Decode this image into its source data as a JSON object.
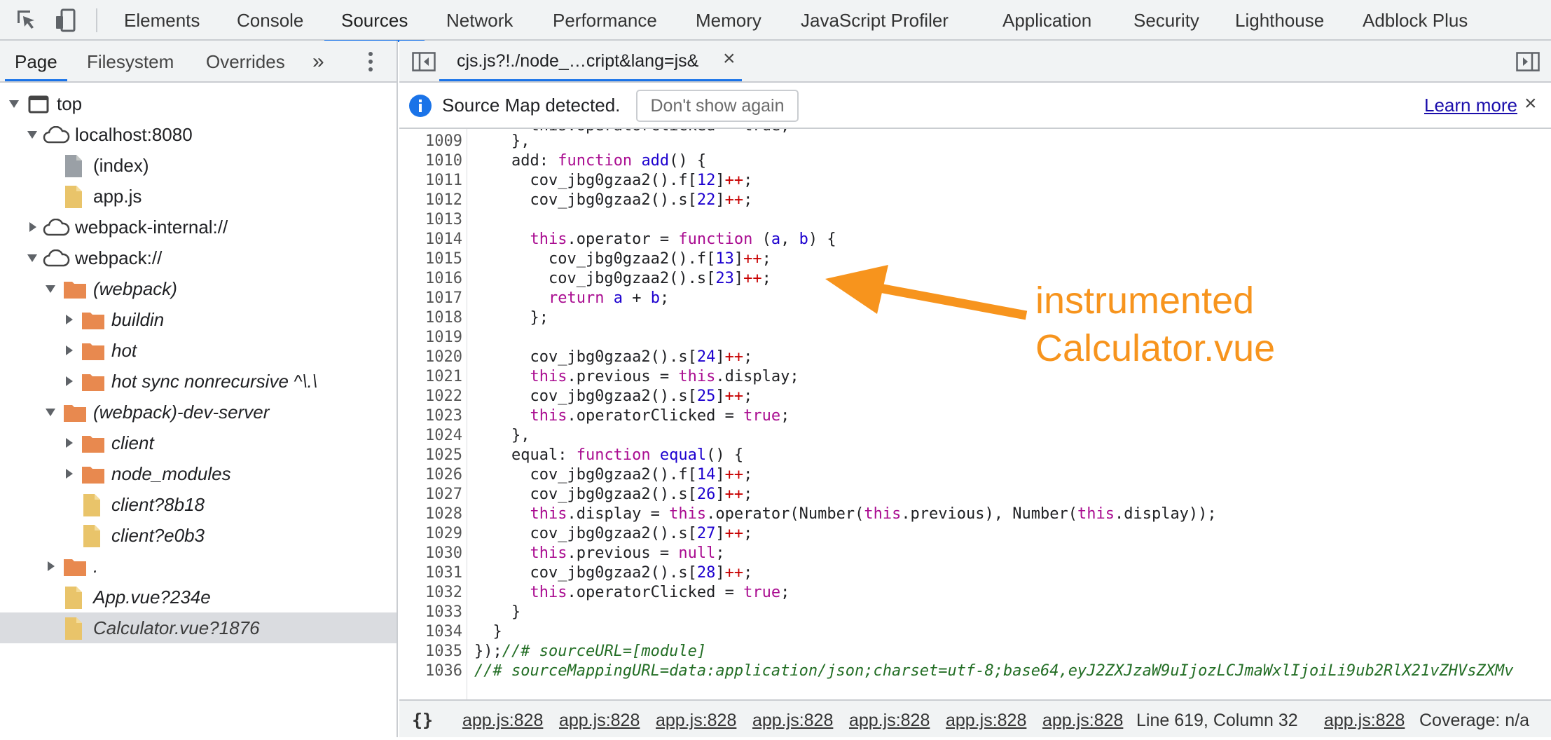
{
  "toolbar": {
    "tabs": [
      "Elements",
      "Console",
      "Sources",
      "Network",
      "Performance",
      "Memory",
      "JavaScript Profiler",
      "Application",
      "Security",
      "Lighthouse",
      "Adblock Plus"
    ],
    "active_tab": "Sources"
  },
  "navigator": {
    "tabs": [
      "Page",
      "Filesystem",
      "Overrides"
    ],
    "more": "»",
    "tree": [
      {
        "label": "top",
        "expanded": true,
        "icon": "frame-icon"
      },
      {
        "label": "localhost:8080",
        "expanded": true,
        "icon": "cloud-icon"
      },
      {
        "label": "(index)",
        "icon": "file-gray-icon"
      },
      {
        "label": "app.js",
        "icon": "file-js-icon"
      },
      {
        "label": "webpack-internal://",
        "expanded": false,
        "icon": "cloud-icon"
      },
      {
        "label": "webpack://",
        "expanded": true,
        "icon": "cloud-icon"
      },
      {
        "label": "(webpack)",
        "expanded": true,
        "icon": "folder-icon"
      },
      {
        "label": "buildin",
        "expanded": false,
        "icon": "folder-icon"
      },
      {
        "label": "hot",
        "expanded": false,
        "icon": "folder-icon"
      },
      {
        "label": "hot sync nonrecursive ^\\.\\",
        "expanded": false,
        "icon": "folder-icon"
      },
      {
        "label": "(webpack)-dev-server",
        "expanded": true,
        "icon": "folder-icon"
      },
      {
        "label": "client",
        "expanded": false,
        "icon": "folder-icon"
      },
      {
        "label": "node_modules",
        "expanded": false,
        "icon": "folder-icon"
      },
      {
        "label": "client?8b18",
        "icon": "file-js-icon"
      },
      {
        "label": "client?e0b3",
        "icon": "file-js-icon"
      },
      {
        "label": ".",
        "expanded": false,
        "icon": "folder-icon"
      },
      {
        "label": "App.vue?234e",
        "icon": "file-js-icon"
      },
      {
        "label": "Calculator.vue?1876",
        "icon": "file-js-icon",
        "selected": true
      }
    ]
  },
  "editor": {
    "file_tab": "cjs.js?!./node_…cript&lang=js&",
    "close": "×",
    "infobar": {
      "message": "Source Map detected.",
      "dont_show": "Don't show again",
      "learn_more": "Learn more",
      "close": "×"
    },
    "partial_top_line": "      this.operatorClicked = true;",
    "lines": [
      {
        "n": "1009",
        "code": [
          {
            "t": "    },"
          }
        ]
      },
      {
        "n": "1010",
        "code": [
          {
            "t": "    add: "
          },
          {
            "t": "function",
            "c": "kw"
          },
          {
            "t": " "
          },
          {
            "t": "add",
            "c": "fn"
          },
          {
            "t": "() {"
          }
        ]
      },
      {
        "n": "1011",
        "code": [
          {
            "t": "      cov_jbg0gzaa2().f["
          },
          {
            "t": "12",
            "c": "num"
          },
          {
            "t": "]"
          },
          {
            "t": "++",
            "c": "op"
          },
          {
            "t": ";"
          }
        ]
      },
      {
        "n": "1012",
        "code": [
          {
            "t": "      cov_jbg0gzaa2().s["
          },
          {
            "t": "22",
            "c": "num"
          },
          {
            "t": "]"
          },
          {
            "t": "++",
            "c": "op"
          },
          {
            "t": ";"
          }
        ]
      },
      {
        "n": "1013",
        "code": [
          {
            "t": ""
          }
        ]
      },
      {
        "n": "1014",
        "code": [
          {
            "t": "      "
          },
          {
            "t": "this",
            "c": "kw"
          },
          {
            "t": ".operator = "
          },
          {
            "t": "function",
            "c": "kw"
          },
          {
            "t": " ("
          },
          {
            "t": "a",
            "c": "fn"
          },
          {
            "t": ", "
          },
          {
            "t": "b",
            "c": "fn"
          },
          {
            "t": ") {"
          }
        ]
      },
      {
        "n": "1015",
        "code": [
          {
            "t": "        cov_jbg0gzaa2().f["
          },
          {
            "t": "13",
            "c": "num"
          },
          {
            "t": "]"
          },
          {
            "t": "++",
            "c": "op"
          },
          {
            "t": ";"
          }
        ]
      },
      {
        "n": "1016",
        "code": [
          {
            "t": "        cov_jbg0gzaa2().s["
          },
          {
            "t": "23",
            "c": "num"
          },
          {
            "t": "]"
          },
          {
            "t": "++",
            "c": "op"
          },
          {
            "t": ";"
          }
        ]
      },
      {
        "n": "1017",
        "code": [
          {
            "t": "        "
          },
          {
            "t": "return",
            "c": "kw"
          },
          {
            "t": " "
          },
          {
            "t": "a",
            "c": "fn"
          },
          {
            "t": " + "
          },
          {
            "t": "b",
            "c": "fn"
          },
          {
            "t": ";"
          }
        ]
      },
      {
        "n": "1018",
        "code": [
          {
            "t": "      };"
          }
        ]
      },
      {
        "n": "1019",
        "code": [
          {
            "t": ""
          }
        ]
      },
      {
        "n": "1020",
        "code": [
          {
            "t": "      cov_jbg0gzaa2().s["
          },
          {
            "t": "24",
            "c": "num"
          },
          {
            "t": "]"
          },
          {
            "t": "++",
            "c": "op"
          },
          {
            "t": ";"
          }
        ]
      },
      {
        "n": "1021",
        "code": [
          {
            "t": "      "
          },
          {
            "t": "this",
            "c": "kw"
          },
          {
            "t": ".previous = "
          },
          {
            "t": "this",
            "c": "kw"
          },
          {
            "t": ".display;"
          }
        ]
      },
      {
        "n": "1022",
        "code": [
          {
            "t": "      cov_jbg0gzaa2().s["
          },
          {
            "t": "25",
            "c": "num"
          },
          {
            "t": "]"
          },
          {
            "t": "++",
            "c": "op"
          },
          {
            "t": ";"
          }
        ]
      },
      {
        "n": "1023",
        "code": [
          {
            "t": "      "
          },
          {
            "t": "this",
            "c": "kw"
          },
          {
            "t": ".operatorClicked = "
          },
          {
            "t": "true",
            "c": "kw"
          },
          {
            "t": ";"
          }
        ]
      },
      {
        "n": "1024",
        "code": [
          {
            "t": "    },"
          }
        ]
      },
      {
        "n": "1025",
        "code": [
          {
            "t": "    equal: "
          },
          {
            "t": "function",
            "c": "kw"
          },
          {
            "t": " "
          },
          {
            "t": "equal",
            "c": "fn"
          },
          {
            "t": "() {"
          }
        ]
      },
      {
        "n": "1026",
        "code": [
          {
            "t": "      cov_jbg0gzaa2().f["
          },
          {
            "t": "14",
            "c": "num"
          },
          {
            "t": "]"
          },
          {
            "t": "++",
            "c": "op"
          },
          {
            "t": ";"
          }
        ]
      },
      {
        "n": "1027",
        "code": [
          {
            "t": "      cov_jbg0gzaa2().s["
          },
          {
            "t": "26",
            "c": "num"
          },
          {
            "t": "]"
          },
          {
            "t": "++",
            "c": "op"
          },
          {
            "t": ";"
          }
        ]
      },
      {
        "n": "1028",
        "code": [
          {
            "t": "      "
          },
          {
            "t": "this",
            "c": "kw"
          },
          {
            "t": ".display = "
          },
          {
            "t": "this",
            "c": "kw"
          },
          {
            "t": ".operator(Number("
          },
          {
            "t": "this",
            "c": "kw"
          },
          {
            "t": ".previous), Number("
          },
          {
            "t": "this",
            "c": "kw"
          },
          {
            "t": ".display));"
          }
        ]
      },
      {
        "n": "1029",
        "code": [
          {
            "t": "      cov_jbg0gzaa2().s["
          },
          {
            "t": "27",
            "c": "num"
          },
          {
            "t": "]"
          },
          {
            "t": "++",
            "c": "op"
          },
          {
            "t": ";"
          }
        ]
      },
      {
        "n": "1030",
        "code": [
          {
            "t": "      "
          },
          {
            "t": "this",
            "c": "kw"
          },
          {
            "t": ".previous = "
          },
          {
            "t": "null",
            "c": "kw"
          },
          {
            "t": ";"
          }
        ]
      },
      {
        "n": "1031",
        "code": [
          {
            "t": "      cov_jbg0gzaa2().s["
          },
          {
            "t": "28",
            "c": "num"
          },
          {
            "t": "]"
          },
          {
            "t": "++",
            "c": "op"
          },
          {
            "t": ";"
          }
        ]
      },
      {
        "n": "1032",
        "code": [
          {
            "t": "      "
          },
          {
            "t": "this",
            "c": "kw"
          },
          {
            "t": ".operatorClicked = "
          },
          {
            "t": "true",
            "c": "kw"
          },
          {
            "t": ";"
          }
        ]
      },
      {
        "n": "1033",
        "code": [
          {
            "t": "    }"
          }
        ]
      },
      {
        "n": "1034",
        "code": [
          {
            "t": "  }"
          }
        ]
      },
      {
        "n": "1035",
        "code": [
          {
            "t": "});"
          },
          {
            "t": "//# sourceURL=[module]",
            "c": "cm"
          }
        ]
      },
      {
        "n": "1036",
        "code": [
          {
            "t": "//# sourceMappingURL=data:application/json;charset=utf-8;base64,eyJ2ZXJzaW9uIjozLCJmaWxlIjoiLi9ub2RlX21vZHVsZXMv",
            "c": "cm"
          }
        ]
      }
    ]
  },
  "status": {
    "format": "{}",
    "links": [
      "app.js:828",
      "app.js:828",
      "app.js:828",
      "app.js:828",
      "app.js:828",
      "app.js:828",
      "app.js:828"
    ],
    "position": "Line 619, Column 32",
    "link_last": "app.js:828",
    "coverage": "Coverage: n/a"
  },
  "annotation": {
    "line1": "instrumented",
    "line2": "Calculator.vue",
    "color": "#f7941d"
  },
  "colors": {
    "accent": "#1a73e8",
    "keyword": "#aa0d91",
    "number": "#1c00cf",
    "comment": "#236e25",
    "folder": "#e8894f",
    "js_file": "#e9c46a"
  }
}
